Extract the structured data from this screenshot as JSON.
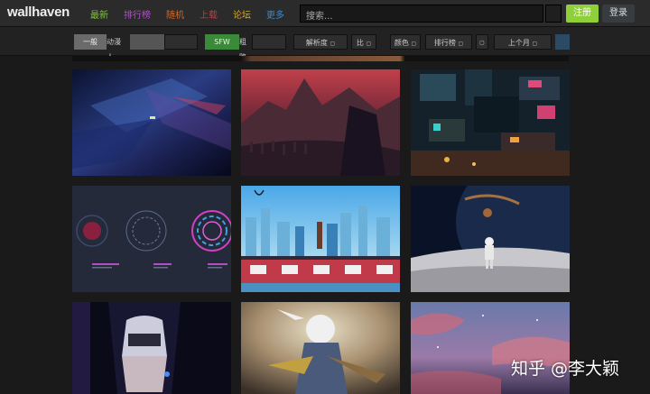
{
  "header": {
    "logo": "wallhaven",
    "nav": [
      {
        "label": "最新",
        "color": "#7fc23a"
      },
      {
        "label": "排行榜",
        "color": "#b050c8"
      },
      {
        "label": "随机",
        "color": "#d06a2a"
      },
      {
        "label": "上载",
        "color": "#c83b3b"
      },
      {
        "label": "论坛",
        "color": "#d8a82a"
      },
      {
        "label": "更多",
        "color": "#3a8ad0"
      }
    ],
    "search_placeholder": "搜索...",
    "register": "注册",
    "login": "登录"
  },
  "filters": {
    "general": "一般",
    "anime_people": "动漫 人",
    "sfw": "SFW",
    "sketchy": "粗略",
    "resolution": "解析度",
    "ratio": "比",
    "color": "颜色",
    "sort": "排行榜",
    "range": "上个月"
  },
  "watermark": "知乎 @李大颖"
}
